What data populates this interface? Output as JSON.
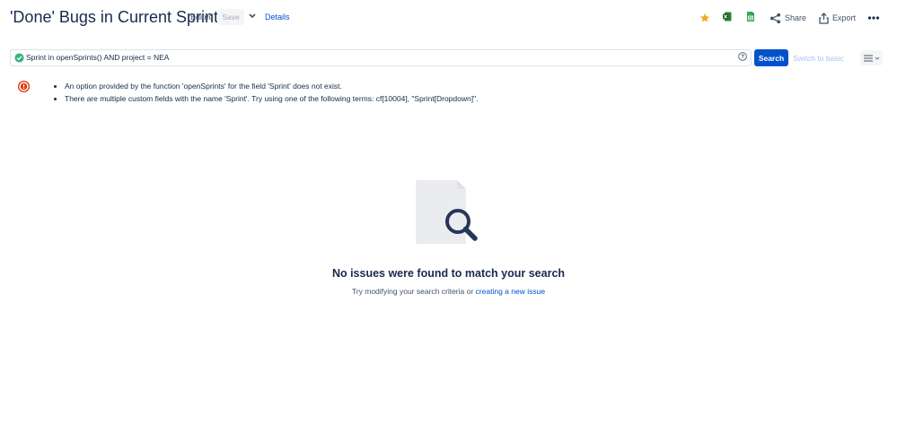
{
  "header": {
    "title": "'Done' Bugs in Current Sprint",
    "edited": "Edited",
    "save": "Save",
    "details": "Details",
    "share": "Share",
    "export": "Export",
    "icons": [
      "star-icon",
      "excel-icon",
      "google-sheets-icon",
      "share-icon",
      "export-icon",
      "more-icon"
    ]
  },
  "search": {
    "query": "Sprint in openSprints() AND project = NEA",
    "button": "Search",
    "switch_to_basic": "Switch to basic"
  },
  "errors": [
    "An option provided by the function 'openSprints' for the field 'Sprint' does not exist.",
    "There are multiple custom fields with the name 'Sprint'. Try using one of the following terms: cf[10004], \"Sprint[Dropdown]\"."
  ],
  "empty_state": {
    "title": "No issues were found to match your search",
    "subtitle": "Try modifying your search criteria or",
    "link": "creating a new issue"
  },
  "colors": {
    "primary": "#0052cc",
    "star": "#f5a623",
    "error": "#de350b",
    "success": "#36b37e",
    "text": "#172b4d"
  }
}
